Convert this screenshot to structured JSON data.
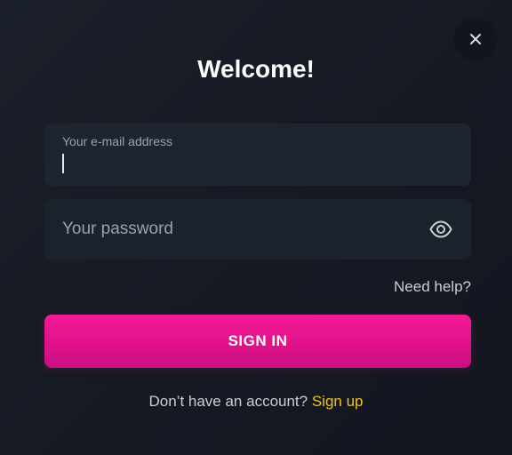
{
  "dialog": {
    "title": "Welcome!",
    "close_icon": "close-icon"
  },
  "email": {
    "label": "Your e-mail address",
    "value": ""
  },
  "password": {
    "placeholder": "Your password",
    "value": "",
    "visibility_icon": "eye-icon"
  },
  "help": {
    "label": "Need help?"
  },
  "signin": {
    "label": "SIGN IN"
  },
  "signup": {
    "prompt": "Don’t have an account?",
    "link": "Sign up"
  },
  "colors": {
    "accent": "#e3128b",
    "link": "#f0c419",
    "background": "#171b24",
    "field": "#1e2530"
  }
}
